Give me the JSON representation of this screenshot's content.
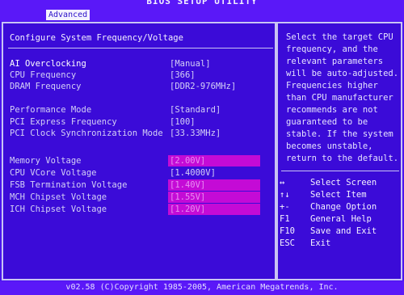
{
  "header": {
    "title": "BIOS SETUP UTILITY",
    "tab": "Advanced"
  },
  "section": {
    "title": "Configure System Frequency/Voltage"
  },
  "settings": [
    {
      "label": "AI Overclocking",
      "value": "[Manual]"
    },
    {
      "label": "CPU Frequency",
      "value": "[366]"
    },
    {
      "label": "DRAM Frequency",
      "value": "[DDR2-976MHz]"
    },
    {
      "label": "Performance Mode",
      "value": "[Standard]"
    },
    {
      "label": "PCI Express Frequency",
      "value": "[100]"
    },
    {
      "label": "PCI Clock Synchronization Mode",
      "value": "[33.33MHz]"
    },
    {
      "label": "Memory Voltage",
      "value": "[2.00V]"
    },
    {
      "label": "CPU VCore Voltage",
      "value": "[1.4000V]"
    },
    {
      "label": "FSB Termination Voltage",
      "value": "[1.40V]"
    },
    {
      "label": "MCH Chipset Voltage",
      "value": "[1.55V]"
    },
    {
      "label": "ICH Chipset Voltage",
      "value": "[1.20V]"
    }
  ],
  "help": {
    "text": "Select the target CPU frequency, and the relevant parameters will be auto-adjusted. Frequencies higher than CPU manufacturer recommends are not guaranteed to be stable. If the system becomes unstable, return to the default."
  },
  "keys": [
    {
      "key": "↔",
      "desc": "Select Screen"
    },
    {
      "key": "↑↓",
      "desc": "Select Item"
    },
    {
      "key": "+-",
      "desc": "Change Option"
    },
    {
      "key": "F1",
      "desc": "General Help"
    },
    {
      "key": "F10",
      "desc": "Save and Exit"
    },
    {
      "key": "ESC",
      "desc": "Exit"
    }
  ],
  "footer": {
    "text": "v02.58 (C)Copyright 1985-2005, American Megatrends, Inc."
  }
}
